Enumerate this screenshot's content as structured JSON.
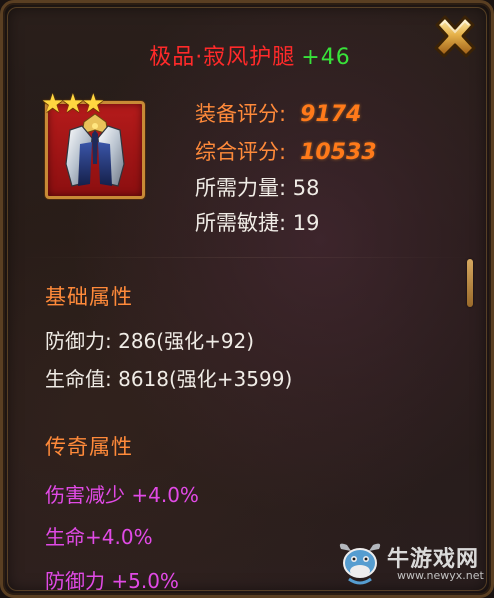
{
  "item": {
    "name": "极品·寂风护腿",
    "enhance": "+46",
    "stars": "★★★"
  },
  "stats": {
    "equip_score_label": "装备评分:",
    "equip_score_value": "9174",
    "total_score_label": "综合评分:",
    "total_score_value": "10533",
    "req_strength": "所需力量: 58",
    "req_agility": "所需敏捷: 19"
  },
  "base_attributes": {
    "title": "基础属性",
    "lines": [
      "防御力: 286(强化+92)",
      "生命值: 8618(强化+3599)"
    ]
  },
  "legend_attributes": {
    "title": "传奇属性",
    "lines": [
      "伤害减少 +4.0%",
      "生命+4.0%",
      "防御力 +5.0%"
    ]
  },
  "watermark": {
    "text": "牛游戏网",
    "url": "www.newyx.net"
  },
  "icons": {
    "close": "close-x-icon",
    "item": "armor-leggings-icon",
    "watermark_logo": "cow-logo-icon"
  },
  "colors": {
    "item_name": "#ff2a2a",
    "enhance": "#38e23a",
    "section_title": "#ff8a3a",
    "legend_text": "#e14ae6",
    "frame_gold": "#c88a36"
  }
}
